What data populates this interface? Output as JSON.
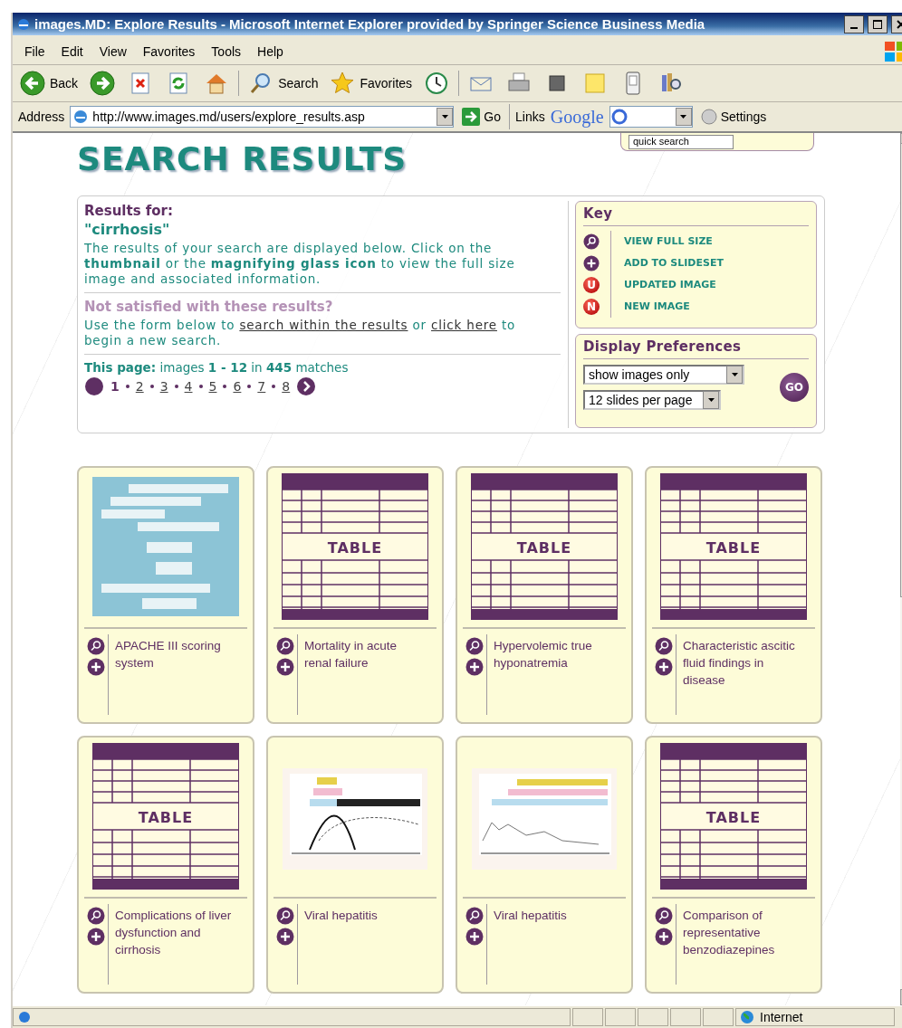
{
  "window": {
    "title": "images.MD: Explore Results - Microsoft Internet Explorer provided by Springer Science Business Media"
  },
  "menu": [
    "File",
    "Edit",
    "View",
    "Favorites",
    "Tools",
    "Help"
  ],
  "toolbar": [
    {
      "kind": "back",
      "label": "Back"
    },
    {
      "kind": "forward"
    },
    {
      "kind": "stop"
    },
    {
      "kind": "refresh"
    },
    {
      "kind": "home"
    },
    {
      "kind": "search",
      "label": "Search"
    },
    {
      "kind": "favorites",
      "label": "Favorites"
    },
    {
      "kind": "history"
    },
    {
      "kind": "mail"
    },
    {
      "kind": "print"
    },
    {
      "kind": "edit"
    },
    {
      "kind": "note"
    },
    {
      "kind": "device"
    },
    {
      "kind": "research"
    }
  ],
  "address_bar": {
    "label": "Address",
    "url": "http://www.images.md/users/explore_results.asp",
    "go": "Go",
    "links": "Links",
    "search_brand": "Google",
    "settings": "Settings"
  },
  "quick_search": {
    "value": "quick search"
  },
  "page_title": "SEARCH RESULTS",
  "results": {
    "heading": "Results for:",
    "query": "\"cirrhosis\"",
    "description": "The results of your search are displayed below. Click on the **thumbnail** or the **magnifying glass icon** to view the full size image and associated information.",
    "not_satisfied": "Not satisfied with these results?",
    "help": [
      {
        "kind": "text",
        "text": "Use the form below to "
      },
      {
        "kind": "link",
        "text": "search within the results"
      },
      {
        "kind": "text",
        "text": " or "
      },
      {
        "kind": "link",
        "text": "click here"
      },
      {
        "kind": "text",
        "text": " to begin a new search."
      }
    ],
    "summary": "**This page:** images **1 - 12** in **445** matches",
    "pages": [
      {
        "label": "1",
        "selected": true
      },
      {
        "label": "2",
        "selected": false
      },
      {
        "label": "3",
        "selected": false
      },
      {
        "label": "4",
        "selected": false
      },
      {
        "label": "5",
        "selected": false
      },
      {
        "label": "6",
        "selected": false
      },
      {
        "label": "7",
        "selected": false
      },
      {
        "label": "8",
        "selected": false
      }
    ]
  },
  "key": {
    "title": "Key",
    "items": [
      {
        "kind": "zoom",
        "label": "VIEW FULL SIZE"
      },
      {
        "kind": "add",
        "label": "ADD TO SLIDESET"
      },
      {
        "kind": "badge",
        "badge": "U",
        "label": "UPDATED IMAGE"
      },
      {
        "kind": "badge",
        "badge": "N",
        "label": "NEW IMAGE"
      }
    ]
  },
  "display_preferences": {
    "title": "Display Preferences",
    "view": "show images only",
    "per_page": "12 slides per page",
    "go": "GO"
  },
  "results_grid": [
    {
      "caption": "APACHE III scoring system"
    },
    {
      "thumbnail": {
        "kind": "table",
        "label": "TABLE"
      },
      "caption": "Mortality in acute renal failure"
    },
    {
      "thumbnail": {
        "kind": "table",
        "label": "TABLE"
      },
      "caption": "Hypervolemic true hyponatremia"
    },
    {
      "thumbnail": {
        "kind": "table",
        "label": "TABLE"
      },
      "caption": "Characteristic ascitic fluid findings in disease"
    },
    {
      "thumbnail": {
        "kind": "table",
        "label": "TABLE"
      },
      "caption": "Complications of liver dysfunction and cirrhosis"
    },
    {
      "caption": "Viral hepatitis"
    },
    {
      "caption": "Viral hepatitis"
    },
    {
      "thumbnail": {
        "kind": "table",
        "label": "TABLE"
      },
      "caption": "Comparison of representative benzodiazepines"
    }
  ],
  "status_bar": {
    "zone": "Internet"
  }
}
